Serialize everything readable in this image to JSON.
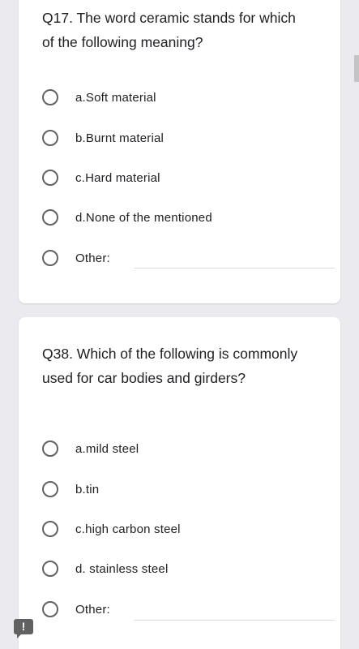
{
  "questions": [
    {
      "title": "Q17. The word ceramic stands for which of the following meaning?",
      "options": [
        "a.Soft material",
        "b.Burnt material",
        "c.Hard material",
        "d.None of the mentioned"
      ],
      "other_label": "Other:"
    },
    {
      "title": "Q38. Which of the following is commonly used for car bodies and girders?",
      "options": [
        "a.mild steel",
        "b.tin",
        "c.high carbon steel",
        "d. stainless steel"
      ],
      "other_label": "Other:"
    }
  ],
  "report_button": {
    "icon": "exclamation-icon",
    "glyph": "!"
  }
}
